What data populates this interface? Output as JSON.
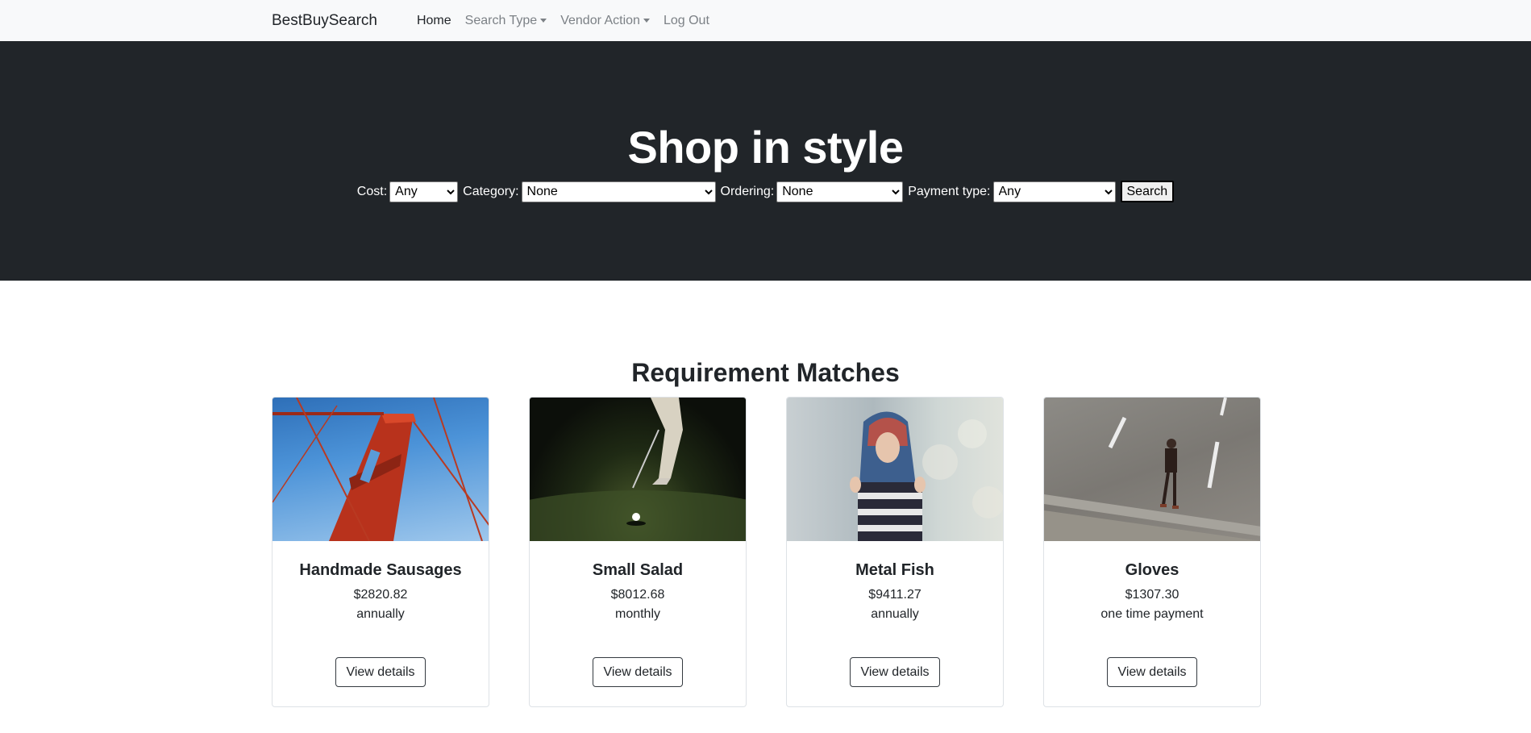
{
  "navbar": {
    "brand": "BestBuySearch",
    "items": [
      {
        "label": "Home",
        "active": true,
        "dropdown": false
      },
      {
        "label": "Search Type",
        "active": false,
        "dropdown": true
      },
      {
        "label": "Vendor Action",
        "active": false,
        "dropdown": true
      },
      {
        "label": "Log Out",
        "active": false,
        "dropdown": false
      }
    ]
  },
  "hero": {
    "title": "Shop in style",
    "filters": {
      "cost_label": "Cost:",
      "cost_value": "Any",
      "category_label": "Category:",
      "category_value": "None",
      "ordering_label": "Ordering:",
      "ordering_value": "None",
      "payment_label": "Payment type:",
      "payment_value": "Any",
      "search_label": "Search"
    }
  },
  "section": {
    "title": "Requirement Matches"
  },
  "cards": [
    {
      "title": "Handmade Sausages",
      "price": "$2820.82",
      "period": "annually",
      "button": "View details",
      "image": "bridge-photo"
    },
    {
      "title": "Small Salad",
      "price": "$8012.68",
      "period": "monthly",
      "button": "View details",
      "image": "golf-photo"
    },
    {
      "title": "Metal Fish",
      "price": "$9411.27",
      "period": "annually",
      "button": "View details",
      "image": "woman-photo"
    },
    {
      "title": "Gloves",
      "price": "$1307.30",
      "period": "one time payment",
      "button": "View details",
      "image": "road-photo"
    }
  ],
  "colors": {
    "navbar_bg": "#f8f9fa",
    "hero_bg": "#212529",
    "text": "#212529",
    "muted_nav": "#7c8186"
  }
}
